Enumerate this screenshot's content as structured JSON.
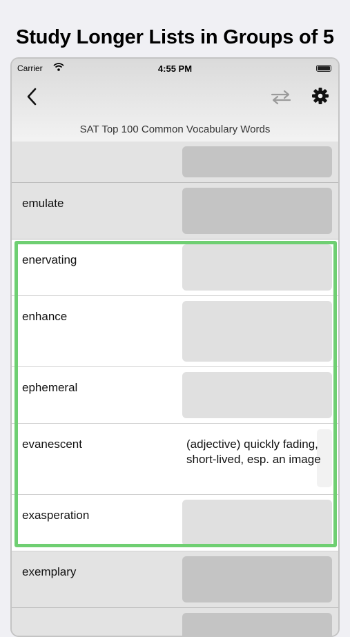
{
  "headline": "Study Longer Lists in Groups of 5",
  "status_bar": {
    "carrier": "Carrier",
    "time": "4:55 PM"
  },
  "nav": {
    "list_title": "SAT Top 100 Common Vocabulary Words"
  },
  "rows": [
    {
      "word": "",
      "definition": ""
    },
    {
      "word": "emulate",
      "definition": ""
    },
    {
      "word": "enervating",
      "definition": ""
    },
    {
      "word": "enhance",
      "definition": ""
    },
    {
      "word": "ephemeral",
      "definition": ""
    },
    {
      "word": "evanescent",
      "definition": "(adjective) quickly fading, short-lived, esp. an image"
    },
    {
      "word": "exasperation",
      "definition": ""
    },
    {
      "word": "exemplary",
      "definition": ""
    },
    {
      "word": "",
      "definition": ""
    }
  ],
  "colors": {
    "highlight": "#6fcf72",
    "hidden_card": "#c4c4c4",
    "active_card": "#e0e0e0"
  }
}
